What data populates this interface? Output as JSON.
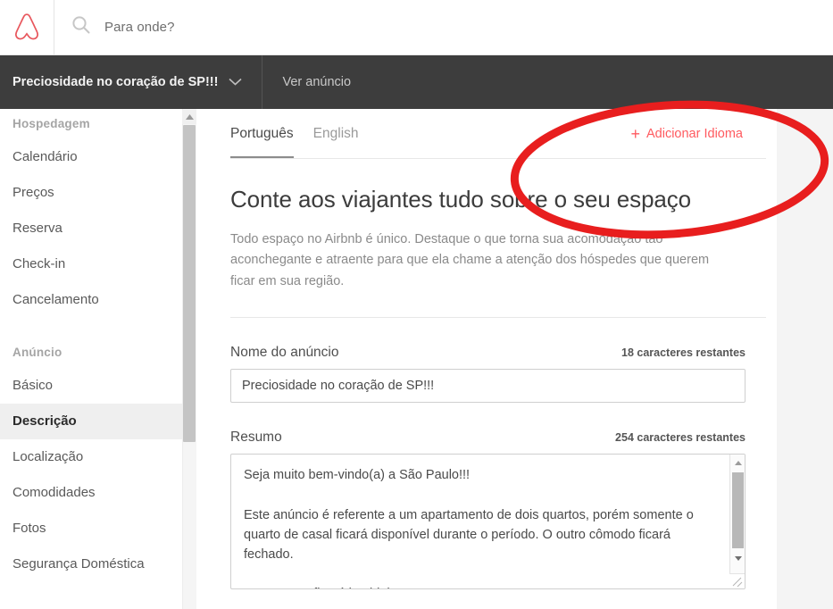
{
  "topbar": {
    "logo_icon": "airbnb-belo-logo",
    "search_icon": "search-icon",
    "search_placeholder": "Para onde?"
  },
  "subheader": {
    "listing_title": "Preciosidade no coração de SP!!!",
    "chevron_icon": "chevron-down-icon",
    "view_listing_label": "Ver anúncio"
  },
  "sidebar": {
    "groups": [
      {
        "label": "Hospedagem",
        "items": [
          "Calendário",
          "Preços",
          "Reserva",
          "Check-in",
          "Cancelamento"
        ]
      },
      {
        "label": "Anúncio",
        "items": [
          "Básico",
          "Descrição",
          "Localização",
          "Comodidades",
          "Fotos",
          "Segurança Doméstica"
        ]
      }
    ],
    "active_item": "Descrição",
    "scroll_up_icon": "scroll-up-arrow-icon"
  },
  "main": {
    "tabs": [
      {
        "label": "Português",
        "active": true
      },
      {
        "label": "English",
        "active": false
      }
    ],
    "add_language": {
      "label": "Adicionar Idioma",
      "plus_icon": "plus-icon",
      "color": "#ff5a5f"
    },
    "heading": "Conte aos viajantes tudo sobre o seu espaço",
    "subtext": "Todo espaço no Airbnb é único. Destaque o que torna sua acomodação tão aconchegante e atraente para que ela chame a atenção dos hóspedes que querem ficar em sua região.",
    "fields": {
      "title": {
        "label": "Nome do anúncio",
        "counter": "18 caracteres restantes",
        "value": "Preciosidade no coração de SP!!!"
      },
      "summary": {
        "label": "Resumo",
        "counter": "254 caracteres restantes",
        "value": "Seja muito bem-vindo(a) a São Paulo!!!\n\nEste anúncio é referente a um apartamento de dois quartos, porém somente o quarto de casal ficará disponível durante o período. O outro cômodo ficará fechado.\n\nMas a casa ficará inteirinha para o seu uso!!!",
        "scroll_up_icon": "scroll-up-arrow-icon",
        "scroll_down_icon": "scroll-down-arrow-icon",
        "resize_icon": "resize-grip-icon"
      }
    }
  },
  "annotation": {
    "shape": "ellipse",
    "color": "#e81e1e",
    "target": "Adicionar Idioma"
  }
}
